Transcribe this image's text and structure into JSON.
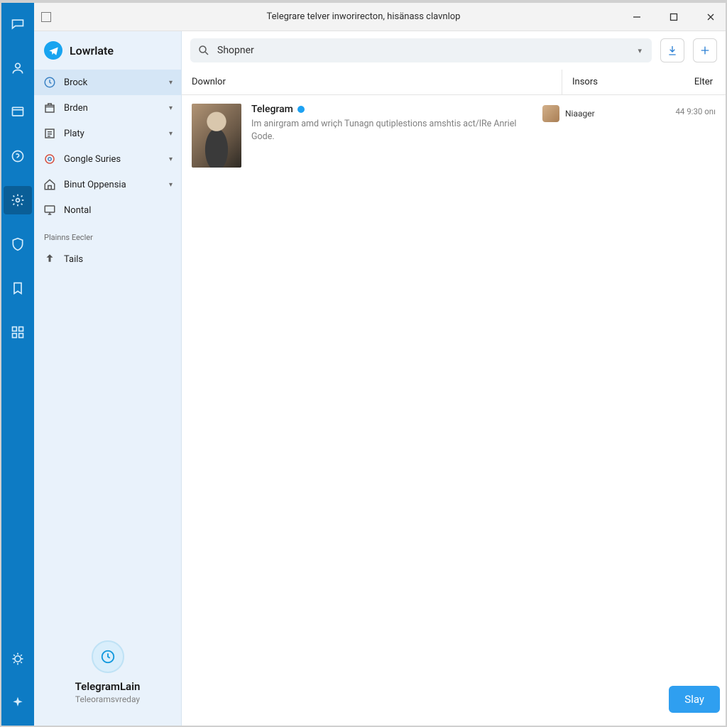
{
  "titlebar": {
    "title": "Telegrare telver inworirecton, hisänass clavnlop"
  },
  "rail": {
    "items": [
      {
        "name": "chat-icon"
      },
      {
        "name": "profile-icon"
      },
      {
        "name": "browser-icon"
      },
      {
        "name": "help-icon"
      },
      {
        "name": "settings-icon"
      },
      {
        "name": "shield-icon"
      },
      {
        "name": "bookmark-icon"
      },
      {
        "name": "grid-icon"
      }
    ],
    "bottom": [
      {
        "name": "bug-icon"
      },
      {
        "name": "sparkle-icon"
      }
    ],
    "active_index": 4
  },
  "sidebar": {
    "header": "Lowrlate",
    "items": [
      {
        "icon": "clock-icon",
        "label": "Brock",
        "expandable": true,
        "active": true
      },
      {
        "icon": "box-icon",
        "label": "Brden",
        "expandable": true
      },
      {
        "icon": "list-icon",
        "label": "Platy",
        "expandable": true
      },
      {
        "icon": "google-icon",
        "label": "Gongle Suries",
        "expandable": true
      },
      {
        "icon": "home-icon",
        "label": "Binut Oppensia",
        "expandable": true
      },
      {
        "icon": "monitor-icon",
        "label": "Nontal",
        "expandable": false
      }
    ],
    "section_label": "Plainns Eecler",
    "extra_items": [
      {
        "icon": "upload-icon",
        "label": "Tails"
      }
    ],
    "footer": {
      "name": "TelegramLain",
      "sub": "Teleoramsvreday"
    }
  },
  "search": {
    "value": "Shopner"
  },
  "toolbar": {
    "download_tip": "download",
    "add_tip": "add"
  },
  "columns": {
    "main": "Downlor",
    "insors": "Insors",
    "etter": "Elter"
  },
  "rows": [
    {
      "title": "Telegram",
      "verified": true,
      "desc": "Im anirgram amd wriçh Tunagn qutiplestions amshtis act/lRe Anriel Gode.",
      "author": "Niaager",
      "time": "44 9:30 onı"
    }
  ],
  "actions": {
    "primary": "Slay"
  }
}
